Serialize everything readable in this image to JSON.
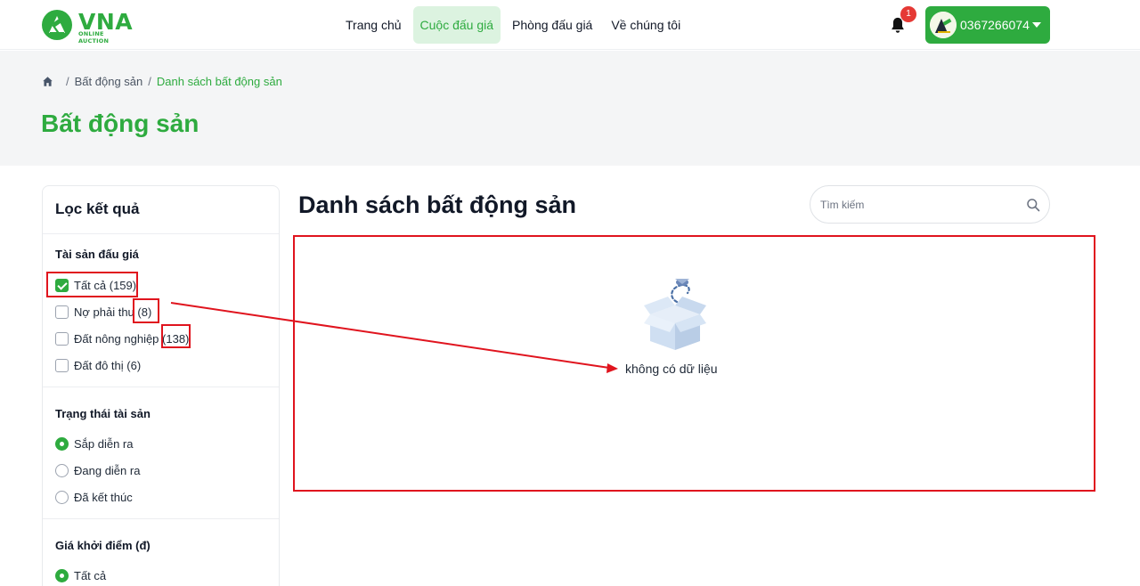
{
  "header": {
    "logo_text": "VNA",
    "logo_sub": "ONLINE AUCTION",
    "nav": [
      {
        "label": "Trang chủ",
        "active": false
      },
      {
        "label": "Cuộc đấu giá",
        "active": true
      },
      {
        "label": "Phòng đấu giá",
        "active": false
      },
      {
        "label": "Về chúng tôi",
        "active": false
      }
    ],
    "notification_count": "1",
    "user_phone": "0367266074"
  },
  "breadcrumb": {
    "items": [
      "Bất động sản",
      "Danh sách bất động sản"
    ]
  },
  "page_title": "Bất động sản",
  "sidebar": {
    "title": "Lọc kết quả",
    "asset_section": {
      "title": "Tài sản đấu giá",
      "options": [
        {
          "label": "Tất cả (159)",
          "checked": true
        },
        {
          "label": "Nợ phải thu (8)",
          "checked": false
        },
        {
          "label": "Đất nông nghiệp (138)",
          "checked": false
        },
        {
          "label": "Đất đô thị (6)",
          "checked": false
        }
      ]
    },
    "status_section": {
      "title": "Trạng thái tài sản",
      "options": [
        {
          "label": "Sắp diễn ra",
          "checked": true
        },
        {
          "label": "Đang diễn ra",
          "checked": false
        },
        {
          "label": "Đã kết thúc",
          "checked": false
        }
      ]
    },
    "price_section": {
      "title": "Giá khởi điểm (đ)",
      "options": [
        {
          "label": "Tất cả",
          "checked": true
        }
      ]
    }
  },
  "main": {
    "title": "Danh sách bất động sản",
    "search_placeholder": "Tìm kiếm",
    "empty_text": "không có dữ liệu"
  },
  "colors": {
    "brand": "#2eab3f",
    "brand_light": "#dcf3e0",
    "annotation": "#e0141e",
    "badge": "#e53935"
  }
}
